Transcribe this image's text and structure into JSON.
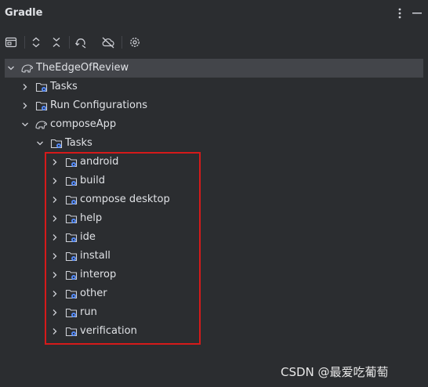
{
  "panel": {
    "title": "Gradle"
  },
  "header": {
    "options_icon": "vertical-ellipsis-icon",
    "hide_icon": "minimize-icon"
  },
  "toolbar": {
    "buttons": [
      {
        "name": "execute-task-button",
        "icon": "terminal-icon"
      },
      {
        "name": "expand-all-button",
        "icon": "expand-all-icon"
      },
      {
        "name": "collapse-all-button",
        "icon": "collapse-all-icon"
      },
      {
        "name": "reload-button",
        "icon": "reload-icon"
      },
      {
        "name": "offline-mode-button",
        "icon": "offline-cloud-icon"
      },
      {
        "name": "settings-button",
        "icon": "gear-icon"
      }
    ]
  },
  "tree": {
    "root": {
      "label": "TheEdgeOfReview",
      "icon": "gradle-elephant-icon",
      "expanded": true
    },
    "root_children": [
      {
        "label": "Tasks",
        "icon": "folder-gear-icon",
        "expanded": false
      },
      {
        "label": "Run Configurations",
        "icon": "folder-gear-icon",
        "expanded": false
      },
      {
        "label": "composeApp",
        "icon": "gradle-elephant-icon",
        "expanded": true
      }
    ],
    "module_tasks": {
      "label": "Tasks",
      "icon": "folder-gear-icon",
      "expanded": true
    },
    "task_groups": [
      {
        "label": "android"
      },
      {
        "label": "build"
      },
      {
        "label": "compose desktop"
      },
      {
        "label": "help"
      },
      {
        "label": "ide"
      },
      {
        "label": "install"
      },
      {
        "label": "interop"
      },
      {
        "label": "other"
      },
      {
        "label": "run"
      },
      {
        "label": "verification"
      }
    ]
  },
  "colors": {
    "background": "#2b2d30",
    "selection": "#43454a",
    "highlight_box": "#d51a1a",
    "folder_gear": "#548af7"
  },
  "watermark": "CSDN @最爱吃葡萄"
}
